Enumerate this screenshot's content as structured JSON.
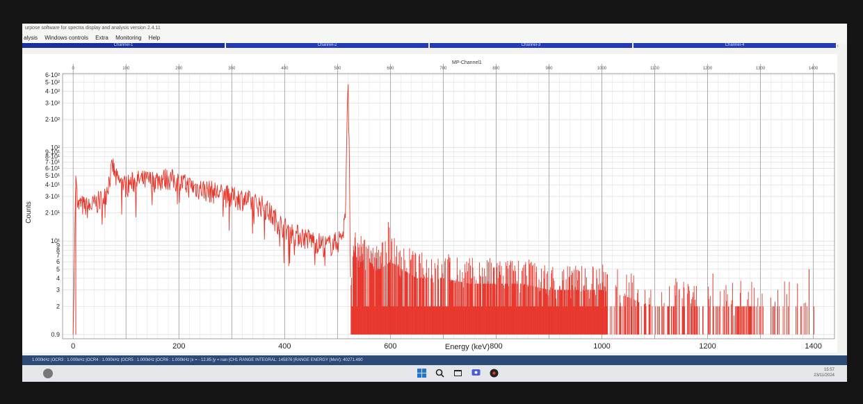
{
  "window": {
    "title": "urpose software for spectra display and analysis version 2.4.11"
  },
  "menu": {
    "items": [
      "alysis",
      "Windows controls",
      "Extra",
      "Monitoring",
      "Help"
    ]
  },
  "window_controls": {
    "minimize": "–",
    "maximize": "□",
    "close": "×"
  },
  "tabs": [
    "Channel-1",
    "Channel-2",
    "Channel-3",
    "Channel-4"
  ],
  "plot": {
    "subtitle": "MP-Channel1"
  },
  "status_bar": {
    "text": "1.000kHz |OCR3 : 1.000kHz |OCR4 : 1.000kHz |OCR5 : 1.000kHz |OCR6 : 1.000kHz |x = - 12.85 |y = nan |CH1 RANGE INTEGRAL: 145876 |RANGE ENERGY (MeV): 40271.490"
  },
  "taskbar": {
    "icons": [
      "windows-start-icon",
      "search-icon",
      "taskview-icon",
      "chat-icon",
      "app-icon"
    ],
    "time": "15:57",
    "date": "23/11/2024"
  },
  "colors": {
    "spectrum": "#e8352a",
    "tab": "#243bb8",
    "status": "#2d4a76"
  },
  "chart_data": {
    "type": "line",
    "xlabel": "Energy (keV)",
    "ylabel": "Counts",
    "yscale": "log",
    "xlim": [
      0,
      1440
    ],
    "ylim": [
      0.9,
      620
    ],
    "x_ticks": [
      0,
      200,
      400,
      600,
      800,
      1000,
      1200,
      1400
    ],
    "x_tick_labels": [
      "0",
      "200",
      "400",
      "600",
      "800",
      "1000",
      "1200",
      "1400"
    ],
    "top_axis_ticks": [
      0,
      100,
      200,
      300,
      400,
      500,
      600,
      700,
      800,
      900,
      1000,
      1100,
      1200,
      1300,
      1400
    ],
    "top_axis_labels": [
      "0",
      "100",
      "200",
      "300",
      "400",
      "500",
      "600",
      "700",
      "800",
      "900",
      "1000",
      "1100",
      "1200",
      "1300",
      "1400"
    ],
    "y_ticks": [
      1,
      2,
      3,
      4,
      5,
      6,
      7,
      8,
      9,
      10,
      20,
      30,
      40,
      50,
      60,
      70,
      80,
      90,
      100,
      200,
      300,
      400,
      500,
      600
    ],
    "y_tick_labels": [
      "0.9",
      "2",
      "3",
      "4",
      "5",
      "6",
      "7",
      "8",
      "9",
      "10¹",
      "2·10¹",
      "3·10¹",
      "4·10¹",
      "5·10¹",
      "6·10¹",
      "7·10¹",
      "8·10¹",
      "9·10¹",
      "10²",
      "2·10²",
      "3·10²",
      "4·10²",
      "5·10²",
      "6·10²"
    ],
    "grid": true,
    "series": [
      {
        "x": [
          0,
          5,
          10,
          15,
          20,
          30,
          40,
          60,
          70,
          75,
          80,
          90,
          100,
          120,
          150,
          180,
          200,
          230,
          260,
          300,
          320,
          340,
          360,
          380,
          400,
          420,
          440,
          460,
          480,
          500,
          510,
          515,
          520,
          522,
          525,
          530,
          540,
          560,
          580,
          600,
          650,
          700,
          750,
          800,
          850,
          900,
          950,
          1000,
          1050,
          1100,
          1150,
          1200,
          1250,
          1300,
          1350,
          1400
        ],
        "y": [
          1,
          50,
          24,
          25,
          24,
          23,
          25,
          30,
          50,
          65,
          48,
          42,
          40,
          45,
          45,
          48,
          43,
          38,
          35,
          30,
          29,
          26,
          24,
          18,
          14,
          12,
          11,
          10,
          9,
          10,
          12,
          20,
          580,
          100,
          3,
          8,
          6,
          6,
          5,
          6,
          4,
          4,
          3.5,
          3.5,
          3.5,
          3,
          3,
          3,
          2.5,
          2,
          2,
          2,
          2,
          2,
          2,
          2
        ]
      }
    ]
  }
}
